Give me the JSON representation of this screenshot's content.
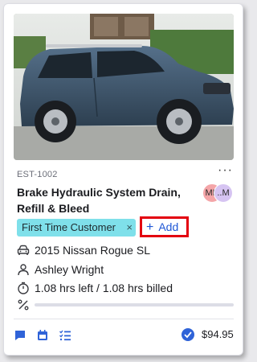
{
  "card": {
    "estimate_id": "EST-1002",
    "more_menu": "···",
    "title": "Brake Hydraulic System Drain, Refill & Bleed",
    "avatars": [
      "MH",
      "..M"
    ],
    "tag": {
      "label": "First Time Customer",
      "remove": "×"
    },
    "add_button": {
      "icon": "+",
      "label": "Add"
    },
    "vehicle": "2015 Nissan Rogue SL",
    "customer": "Ashley Wright",
    "hours": "1.08 hrs left / 1.08 hrs billed",
    "progress_fraction": 0,
    "total": "$94.95",
    "icons": {
      "vehicle": "car-icon",
      "customer": "person-icon",
      "hours": "stopwatch-icon",
      "progress": "percent-icon",
      "footer": [
        "chat-icon",
        "calendar-icon",
        "checklist-icon"
      ],
      "total": "check-circle-icon"
    },
    "colors": {
      "accent": "#1f57d6",
      "tag": "#7fe0ea",
      "highlight": "#e3000f",
      "car": "#3d5366"
    }
  }
}
